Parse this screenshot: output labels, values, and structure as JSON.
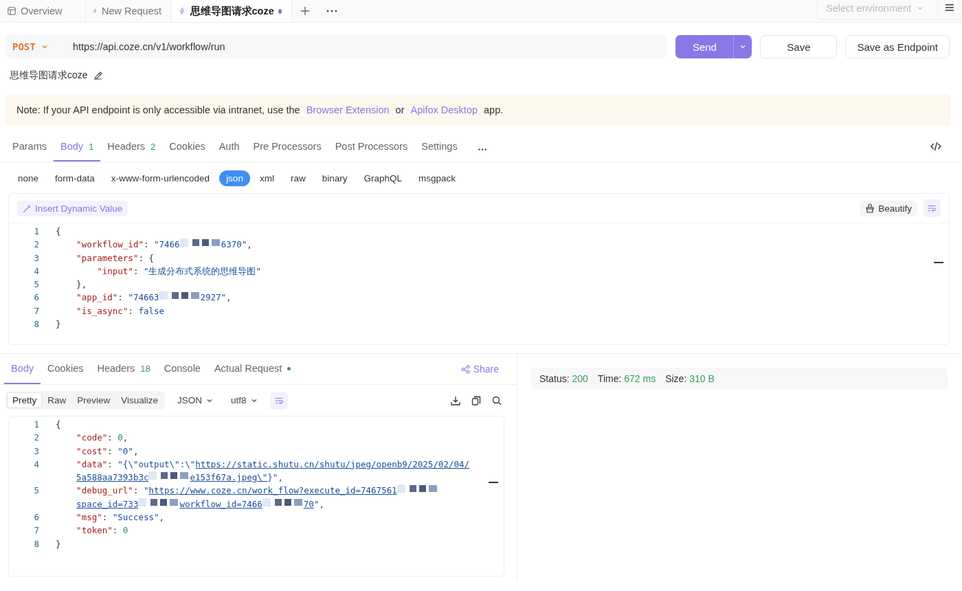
{
  "top_tabs": [
    {
      "kind": "overview",
      "label": "Overview",
      "selected": false,
      "modified": false
    },
    {
      "kind": "request",
      "label": "New Request",
      "selected": false,
      "modified": false
    },
    {
      "kind": "request",
      "label": "思维导图请求coze",
      "selected": true,
      "modified": true
    }
  ],
  "environment": {
    "placeholder": "Select environment"
  },
  "request": {
    "method": "POST",
    "url": "https://api.coze.cn/v1/workflow/run",
    "buttons": [
      "Send",
      "Save",
      "Save as Endpoint"
    ],
    "name": "思维导图请求coze"
  },
  "note": {
    "prefix": "Note: If your API endpoint is only accessible via intranet, use the",
    "link1": "Browser Extension",
    "middle": "or",
    "link2": "Apifox Desktop",
    "suffix": "app."
  },
  "request_tabs": [
    {
      "label": "Params",
      "selected": false
    },
    {
      "label": "Body",
      "count": "1",
      "selected": true
    },
    {
      "label": "Headers",
      "count": "2",
      "selected": false
    },
    {
      "label": "Cookies",
      "selected": false
    },
    {
      "label": "Auth",
      "selected": false
    },
    {
      "label": "Pre Processors",
      "selected": false
    },
    {
      "label": "Post Processors",
      "selected": false
    },
    {
      "label": "Settings",
      "selected": false
    }
  ],
  "body_types": [
    {
      "label": "none",
      "selected": false
    },
    {
      "label": "form-data",
      "selected": false
    },
    {
      "label": "x-www-form-urlencoded",
      "selected": false
    },
    {
      "label": "json",
      "selected": true
    },
    {
      "label": "xml",
      "selected": false
    },
    {
      "label": "raw",
      "selected": false
    },
    {
      "label": "binary",
      "selected": false
    },
    {
      "label": "GraphQL",
      "selected": false
    },
    {
      "label": "msgpack",
      "selected": false
    }
  ],
  "editor": {
    "insert_label": "Insert Dynamic Value",
    "beautify_label": "Beautify",
    "lines": [
      {
        "number": "1",
        "rows": [
          [
            {
              "kind": "punct",
              "text": "{"
            }
          ]
        ]
      },
      {
        "number": "2",
        "rows": [
          [
            {
              "kind": "key",
              "text": "    \"workflow_id\""
            },
            {
              "kind": "punct",
              "text": ": "
            },
            {
              "kind": "str",
              "text": "\"7466"
            },
            {
              "kind": "redacted"
            },
            {
              "kind": "str",
              "text": "6370\""
            },
            {
              "kind": "punct",
              "text": ","
            }
          ]
        ]
      },
      {
        "number": "3",
        "rows": [
          [
            {
              "kind": "key",
              "text": "    \"parameters\""
            },
            {
              "kind": "punct",
              "text": ": {"
            }
          ]
        ]
      },
      {
        "number": "4",
        "rows": [
          [
            {
              "kind": "key",
              "text": "        \"input\""
            },
            {
              "kind": "punct",
              "text": ": "
            },
            {
              "kind": "str",
              "text": "\"生成分布式系统的思维导图\""
            }
          ]
        ]
      },
      {
        "number": "5",
        "rows": [
          [
            {
              "kind": "punct",
              "text": "    },"
            }
          ]
        ]
      },
      {
        "number": "6",
        "rows": [
          [
            {
              "kind": "key",
              "text": "    \"app_id\""
            },
            {
              "kind": "punct",
              "text": ": "
            },
            {
              "kind": "str",
              "text": "\"74663"
            },
            {
              "kind": "redacted"
            },
            {
              "kind": "str",
              "text": "2927\""
            },
            {
              "kind": "punct",
              "text": ","
            }
          ]
        ]
      },
      {
        "number": "7",
        "rows": [
          [
            {
              "kind": "key",
              "text": "    \"is_async\""
            },
            {
              "kind": "punct",
              "text": ": "
            },
            {
              "kind": "bool",
              "text": "false"
            }
          ]
        ]
      },
      {
        "number": "8",
        "rows": [
          [
            {
              "kind": "punct",
              "text": "}"
            }
          ]
        ]
      }
    ]
  },
  "response": {
    "tabs": [
      {
        "label": "Body",
        "selected": true,
        "indicator": false
      },
      {
        "label": "Cookies",
        "selected": false,
        "indicator": false
      },
      {
        "label": "Headers",
        "count": "18",
        "selected": false,
        "indicator": false
      },
      {
        "label": "Console",
        "selected": false,
        "indicator": false
      },
      {
        "label": "Actual Request",
        "selected": false,
        "indicator": true
      }
    ],
    "share_label": "Share",
    "views": [
      {
        "label": "Pretty",
        "selected": true
      },
      {
        "label": "Raw",
        "selected": false
      },
      {
        "label": "Preview",
        "selected": false
      },
      {
        "label": "Visualize",
        "selected": false
      }
    ],
    "format": "JSON",
    "encoding": "utf8",
    "lines": [
      {
        "number": "1",
        "rows": [
          [
            {
              "kind": "punct",
              "text": "{"
            }
          ]
        ]
      },
      {
        "number": "2",
        "rows": [
          [
            {
              "kind": "key",
              "text": "    \"code\""
            },
            {
              "kind": "punct",
              "text": ": "
            },
            {
              "kind": "num",
              "text": "0"
            },
            {
              "kind": "punct",
              "text": ","
            }
          ]
        ]
      },
      {
        "number": "3",
        "rows": [
          [
            {
              "kind": "key",
              "text": "    \"cost\""
            },
            {
              "kind": "punct",
              "text": ": "
            },
            {
              "kind": "str",
              "text": "\"0\""
            },
            {
              "kind": "punct",
              "text": ","
            }
          ]
        ]
      },
      {
        "number": "4",
        "rows": [
          [
            {
              "kind": "key",
              "text": "    \"data\""
            },
            {
              "kind": "punct",
              "text": ": "
            },
            {
              "kind": "str",
              "text": "\"{\\\"output\\\":\\\""
            },
            {
              "kind": "link",
              "text": "https://static.shutu.cn/shutu/jpeg/openb9/2025/02/04/"
            }
          ]
        ],
        "wrapped": [
          {
            "kind": "link",
            "text": "5a588aa7393b3c"
          },
          {
            "kind": "redacted"
          },
          {
            "kind": "link",
            "text": "e153f67a.jpeg\\\""
          },
          {
            "kind": "str",
            "text": "}\","
          }
        ]
      },
      {
        "number": "5",
        "rows": [
          [
            {
              "kind": "key",
              "text": "    \"debug_url\""
            },
            {
              "kind": "punct",
              "text": ": "
            },
            {
              "kind": "str",
              "text": "\""
            },
            {
              "kind": "link",
              "text": "https://www.coze.cn/work_flow?execute_id=7467561"
            },
            {
              "kind": "redacted"
            }
          ]
        ],
        "wrapped": [
          {
            "kind": "link",
            "text": "space_id=733"
          },
          {
            "kind": "redacted"
          },
          {
            "kind": "link",
            "text": "workflow_id=7466"
          },
          {
            "kind": "redacted"
          },
          {
            "kind": "link",
            "text": "70"
          },
          {
            "kind": "str",
            "text": "\","
          }
        ]
      },
      {
        "number": "6",
        "rows": [
          [
            {
              "kind": "key",
              "text": "    \"msg\""
            },
            {
              "kind": "punct",
              "text": ": "
            },
            {
              "kind": "str",
              "text": "\"Success\""
            },
            {
              "kind": "punct",
              "text": ","
            }
          ]
        ]
      },
      {
        "number": "7",
        "rows": [
          [
            {
              "kind": "key",
              "text": "    \"token\""
            },
            {
              "kind": "punct",
              "text": ": "
            },
            {
              "kind": "num",
              "text": "0"
            }
          ]
        ]
      },
      {
        "number": "8",
        "rows": [
          [
            {
              "kind": "punct",
              "text": "}"
            }
          ]
        ]
      }
    ],
    "status": [
      {
        "label": "Status:",
        "value": "200"
      },
      {
        "label": "Time:",
        "value": "672 ms"
      },
      {
        "label": "Size:",
        "value": "310 B"
      }
    ]
  }
}
